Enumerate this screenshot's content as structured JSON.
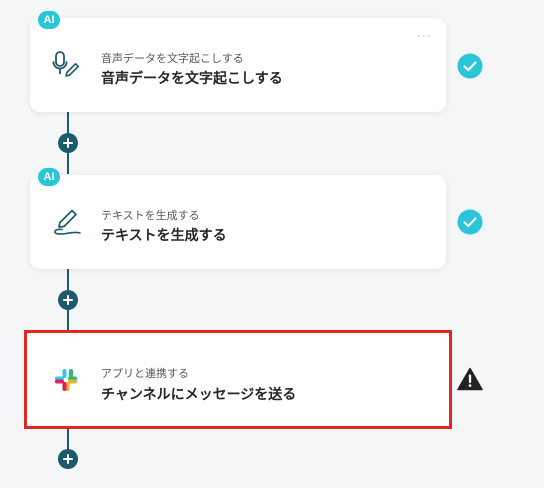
{
  "colors": {
    "connector": "#1d5a6d",
    "accent_teal": "#2ac5d9",
    "highlight_border": "#e1261c",
    "warning": "#222222"
  },
  "steps": [
    {
      "badge": "AI",
      "icon": "microphone-pen-icon",
      "subtitle": "音声データを文字起こしする",
      "title": "音声データを文字起こしする",
      "status": "check-circle-icon",
      "more_label": "···"
    },
    {
      "badge": "AI",
      "icon": "pen-line-icon",
      "subtitle": "テキストを生成する",
      "title": "テキストを生成する",
      "status": "check-circle-icon"
    },
    {
      "badge": "",
      "icon": "slack-icon",
      "subtitle": "アプリと連携する",
      "title": "チャンネルにメッセージを送る",
      "status": "warning-triangle-icon"
    }
  ]
}
